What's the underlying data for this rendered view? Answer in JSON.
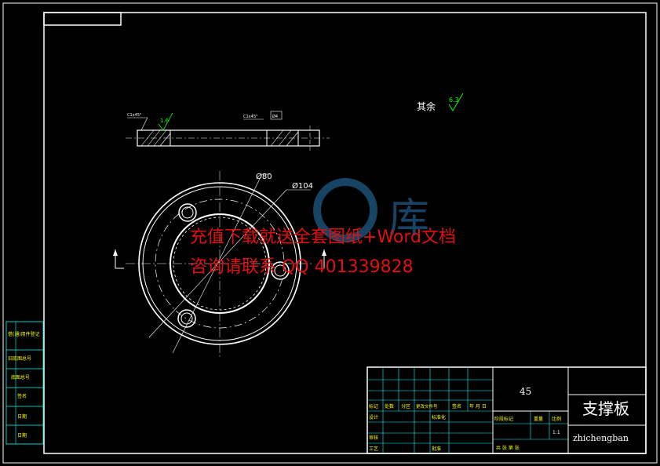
{
  "drawing": {
    "material": "45",
    "part_name_cn": "支撑板",
    "part_name_pinyin": "zhichengban",
    "roughness_note": "其余",
    "roughness_other": "6.3",
    "roughness_side": "1.6",
    "dim_hole_circle": "Ø80",
    "dim_outer": "Ø104",
    "chamfer_left": "C1x45°",
    "chamfer_right": "C1x45°",
    "dim_small": "Ø4",
    "scale": "1:1"
  },
  "title_block": {
    "row_labels": [
      "标记",
      "处数",
      "分区",
      "更改文件号",
      "签名",
      "年 月 日"
    ],
    "design": "设计",
    "standard": "标准化",
    "check": "审核",
    "craft": "工艺",
    "approve": "批准",
    "stage": "阶段标记",
    "weight": "重量",
    "scale_label": "比例",
    "sheet": "共 张 第 张"
  },
  "side_strip": [
    "借(通)用件登记",
    "旧底图总号",
    "底图总号",
    "签名",
    "日期",
    "日期"
  ],
  "watermark": {
    "line1": "充值下载就送全套图纸+Word文档",
    "line2": "咨询请联系 QQ 401339828"
  },
  "colors": {
    "line": "#ffffff",
    "aux": "#00ffff",
    "dim": "#ffffff",
    "watermark": "#e01010"
  }
}
